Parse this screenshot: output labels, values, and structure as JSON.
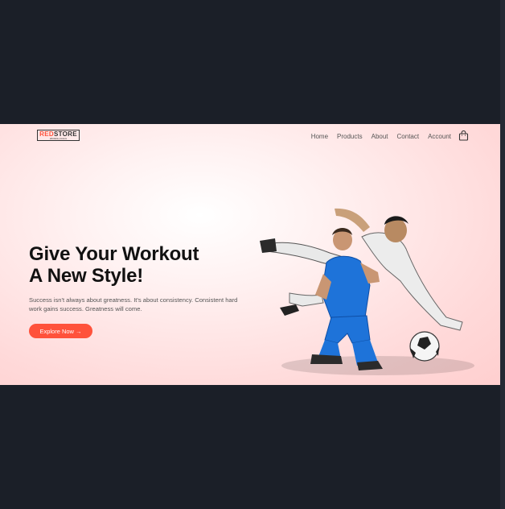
{
  "brand": {
    "logo_primary": "RED",
    "logo_secondary": "STORE",
    "logo_tagline": "affordable products",
    "accent_color": "#ff523b"
  },
  "nav": {
    "items": [
      {
        "label": "Home"
      },
      {
        "label": "Products"
      },
      {
        "label": "About"
      },
      {
        "label": "Contact"
      },
      {
        "label": "Account"
      }
    ],
    "cart_icon": "shopping-bag-icon"
  },
  "hero": {
    "title_line1": "Give Your Workout",
    "title_line2": "A New Style!",
    "description": "Success isn't always about greatness. It's about consistency. Consistent hard work gains success. Greatness will come.",
    "cta_label": "Explore Now →",
    "image": "soccer-players-image"
  }
}
